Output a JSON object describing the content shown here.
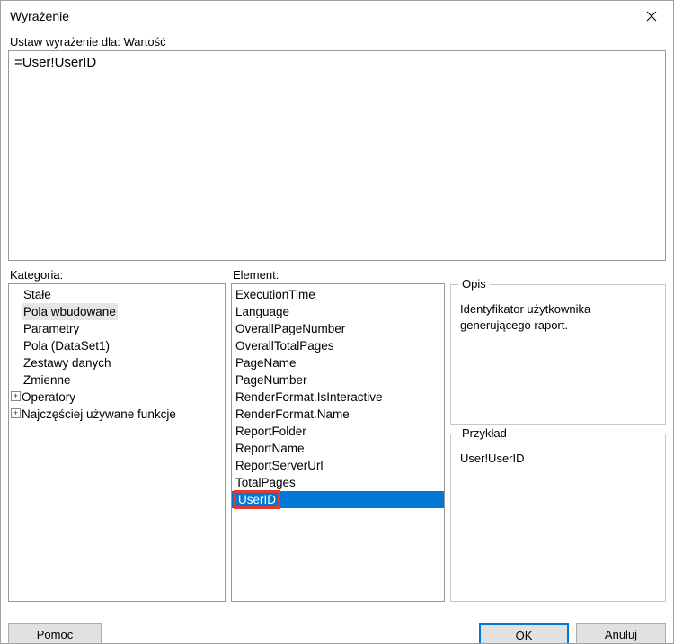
{
  "title": "Wyrażenie",
  "fieldLabel": "Ustaw wyrażenie dla: Wartość",
  "expression": "=User!UserID",
  "category": {
    "label": "Kategoria:",
    "items": [
      {
        "label": "Stałe",
        "expand": false,
        "hl": false
      },
      {
        "label": "Pola wbudowane",
        "expand": false,
        "hl": true
      },
      {
        "label": "Parametry",
        "expand": false,
        "hl": false
      },
      {
        "label": "Pola (DataSet1)",
        "expand": false,
        "hl": false
      },
      {
        "label": "Zestawy danych",
        "expand": false,
        "hl": false
      },
      {
        "label": "Zmienne",
        "expand": false,
        "hl": false
      },
      {
        "label": "Operatory",
        "expand": true,
        "hl": false
      },
      {
        "label": "Najczęściej używane funkcje",
        "expand": true,
        "hl": false
      }
    ]
  },
  "element": {
    "label": "Element:",
    "items": [
      {
        "label": "ExecutionTime",
        "selected": false
      },
      {
        "label": "Language",
        "selected": false
      },
      {
        "label": "OverallPageNumber",
        "selected": false
      },
      {
        "label": "OverallTotalPages",
        "selected": false
      },
      {
        "label": "PageName",
        "selected": false
      },
      {
        "label": "PageNumber",
        "selected": false
      },
      {
        "label": "RenderFormat.IsInteractive",
        "selected": false
      },
      {
        "label": "RenderFormat.Name",
        "selected": false
      },
      {
        "label": "ReportFolder",
        "selected": false
      },
      {
        "label": "ReportName",
        "selected": false
      },
      {
        "label": "ReportServerUrl",
        "selected": false
      },
      {
        "label": "TotalPages",
        "selected": false
      },
      {
        "label": "UserID",
        "selected": true
      }
    ]
  },
  "descGroup": {
    "legend": "Opis",
    "text": "Identyfikator użytkownika generującego raport."
  },
  "exampleGroup": {
    "legend": "Przykład",
    "text": "User!UserID"
  },
  "buttons": {
    "help": "Pomoc",
    "ok": "OK",
    "cancel": "Anuluj"
  }
}
